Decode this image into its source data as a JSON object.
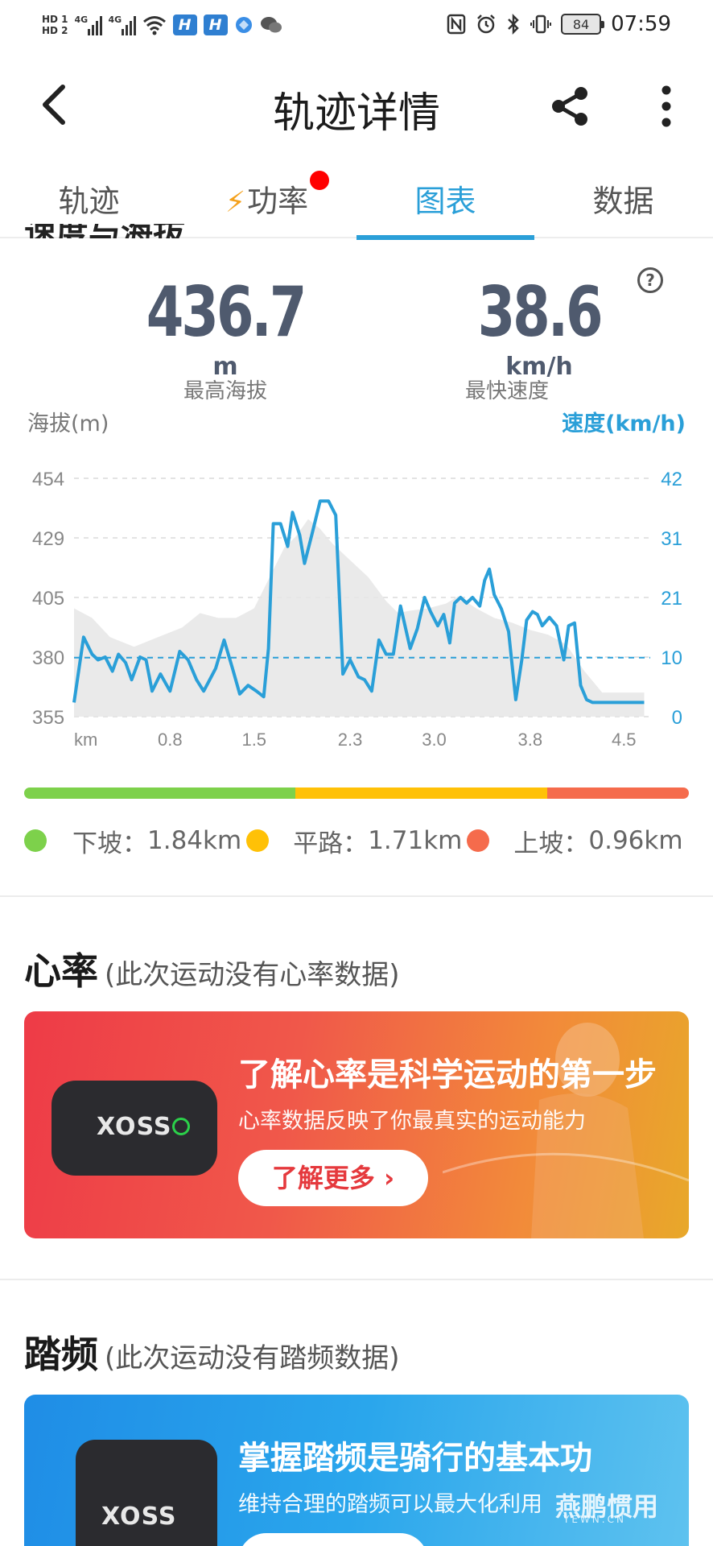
{
  "status_bar": {
    "hd1": "HD 1",
    "hd2": "HD 2",
    "net1": "4G",
    "net2": "4G",
    "battery": "84",
    "time": "07:59",
    "badge1": "H",
    "badge2": "H"
  },
  "header": {
    "title": "轨迹详情"
  },
  "tabs": [
    {
      "label": "轨迹"
    },
    {
      "label": "功率"
    },
    {
      "label": "图表"
    },
    {
      "label": "数据"
    }
  ],
  "speed_elevation": {
    "heading": "速度与海拔",
    "max_elevation": {
      "value": "436.7",
      "unit": "m",
      "caption": "最高海拔"
    },
    "max_speed": {
      "value": "38.6",
      "unit": "km/h",
      "caption": "最快速度"
    },
    "help_icon": "?",
    "left_axis_title": "海拔(m)",
    "right_axis_title": "速度(km/h)",
    "colors": {
      "speed_line": "#2a9fd8",
      "elevation_fill": "#e6e6e6",
      "avg_line": "#2a9fd8"
    }
  },
  "chart_data": {
    "type": "line",
    "x_label_unit": "km",
    "x_ticks": [
      "0.8",
      "1.5",
      "2.3",
      "3.0",
      "3.8",
      "4.5"
    ],
    "x_range": [
      0,
      4.8
    ],
    "y_left": {
      "label": "海拔(m)",
      "ticks": [
        "454",
        "429",
        "405",
        "380",
        "355"
      ],
      "range": [
        355,
        454
      ]
    },
    "y_right": {
      "label": "速度(km/h)",
      "ticks": [
        "42",
        "31",
        "21",
        "10",
        "0"
      ],
      "range": [
        0,
        42
      ]
    },
    "average_speed": 10.4,
    "series": [
      {
        "name": "海拔",
        "x": [
          0,
          0.15,
          0.3,
          0.5,
          0.7,
          0.9,
          1.05,
          1.2,
          1.35,
          1.5,
          1.6,
          1.75,
          1.85,
          1.95,
          2.05,
          2.15,
          2.3,
          2.45,
          2.6,
          2.7,
          2.8,
          2.95,
          3.1,
          3.2,
          3.35,
          3.5,
          3.65,
          3.8,
          3.95,
          4.1,
          4.25,
          4.4,
          4.55,
          4.75
        ],
        "values": [
          400,
          396,
          388,
          384,
          388,
          392,
          398,
          396,
          396,
          400,
          410,
          425,
          430,
          437,
          433,
          427,
          420,
          413,
          403,
          398,
          399,
          400,
          402,
          405,
          400,
          396,
          394,
          391,
          389,
          385,
          374,
          365,
          365,
          365
        ]
      },
      {
        "name": "速度",
        "x": [
          0,
          0.08,
          0.15,
          0.2,
          0.26,
          0.32,
          0.37,
          0.43,
          0.48,
          0.55,
          0.6,
          0.65,
          0.72,
          0.8,
          0.88,
          0.95,
          1.02,
          1.08,
          1.13,
          1.18,
          1.25,
          1.32,
          1.38,
          1.45,
          1.52,
          1.58,
          1.62,
          1.66,
          1.72,
          1.78,
          1.82,
          1.88,
          1.92,
          1.98,
          2.05,
          2.12,
          2.18,
          2.24,
          2.3,
          2.37,
          2.42,
          2.48,
          2.54,
          2.6,
          2.66,
          2.72,
          2.8,
          2.86,
          2.92,
          2.97,
          3.03,
          3.08,
          3.13,
          3.17,
          3.22,
          3.27,
          3.32,
          3.38,
          3.42,
          3.46,
          3.5,
          3.56,
          3.62,
          3.68,
          3.73,
          3.77,
          3.82,
          3.86,
          3.9,
          3.96,
          4.02,
          4.08,
          4.12,
          4.17,
          4.22,
          4.27,
          4.32,
          4.37,
          4.42,
          4.47,
          4.52,
          4.57,
          4.62,
          4.68,
          4.75
        ],
        "values": [
          2.5,
          14,
          11,
          10,
          10.5,
          8,
          11,
          9.5,
          6.5,
          10.5,
          10,
          4.5,
          7.5,
          4.5,
          11.5,
          10,
          6.5,
          4.5,
          6.5,
          8.5,
          13.5,
          8.5,
          4,
          5.5,
          4.5,
          3.5,
          12,
          34,
          34,
          30,
          36,
          32,
          27,
          32,
          38,
          38,
          35.5,
          7.5,
          10,
          7,
          6.5,
          4.5,
          13.5,
          11,
          11,
          19.5,
          12,
          15.5,
          21,
          18.5,
          16,
          18,
          13,
          20,
          21,
          20,
          21,
          19.5,
          24,
          26,
          21.5,
          19,
          15,
          3,
          10,
          17,
          18.5,
          18,
          16,
          17.5,
          16,
          10,
          16,
          16.5,
          5.5,
          3,
          2.5,
          2.5,
          2.5,
          2.5,
          2.5,
          2.5,
          2.5,
          2.5,
          2.5
        ]
      }
    ]
  },
  "slope_summary": {
    "segments": [
      {
        "label": "下坡：",
        "value": "1.84km",
        "color": "#7dd14b",
        "ratio": 1.84
      },
      {
        "label": "平路：",
        "value": "1.71km",
        "color": "#ffc107",
        "ratio": 1.71
      },
      {
        "label": "上坡：",
        "value": "0.96km",
        "color": "#f56b4c",
        "ratio": 0.96
      }
    ]
  },
  "heart_rate": {
    "title": "心率",
    "note": "(此次运动没有心率数据)",
    "banner_headline": "了解心率是科学运动的第一步",
    "banner_sub": "心率数据反映了你最真实的运动能力",
    "cta_label": "了解更多 ›",
    "device_brand": "XOSS"
  },
  "cadence": {
    "title": "踏频",
    "note": "(此次运动没有踏频数据)",
    "banner_headline": "掌握踏频是骑行的基本功",
    "banner_sub": "维持合理的踏频可以最大化利用",
    "device_brand": "XOSS"
  },
  "watermark": {
    "text": "燕鹏惯用",
    "sub": "YEWN.CN"
  }
}
